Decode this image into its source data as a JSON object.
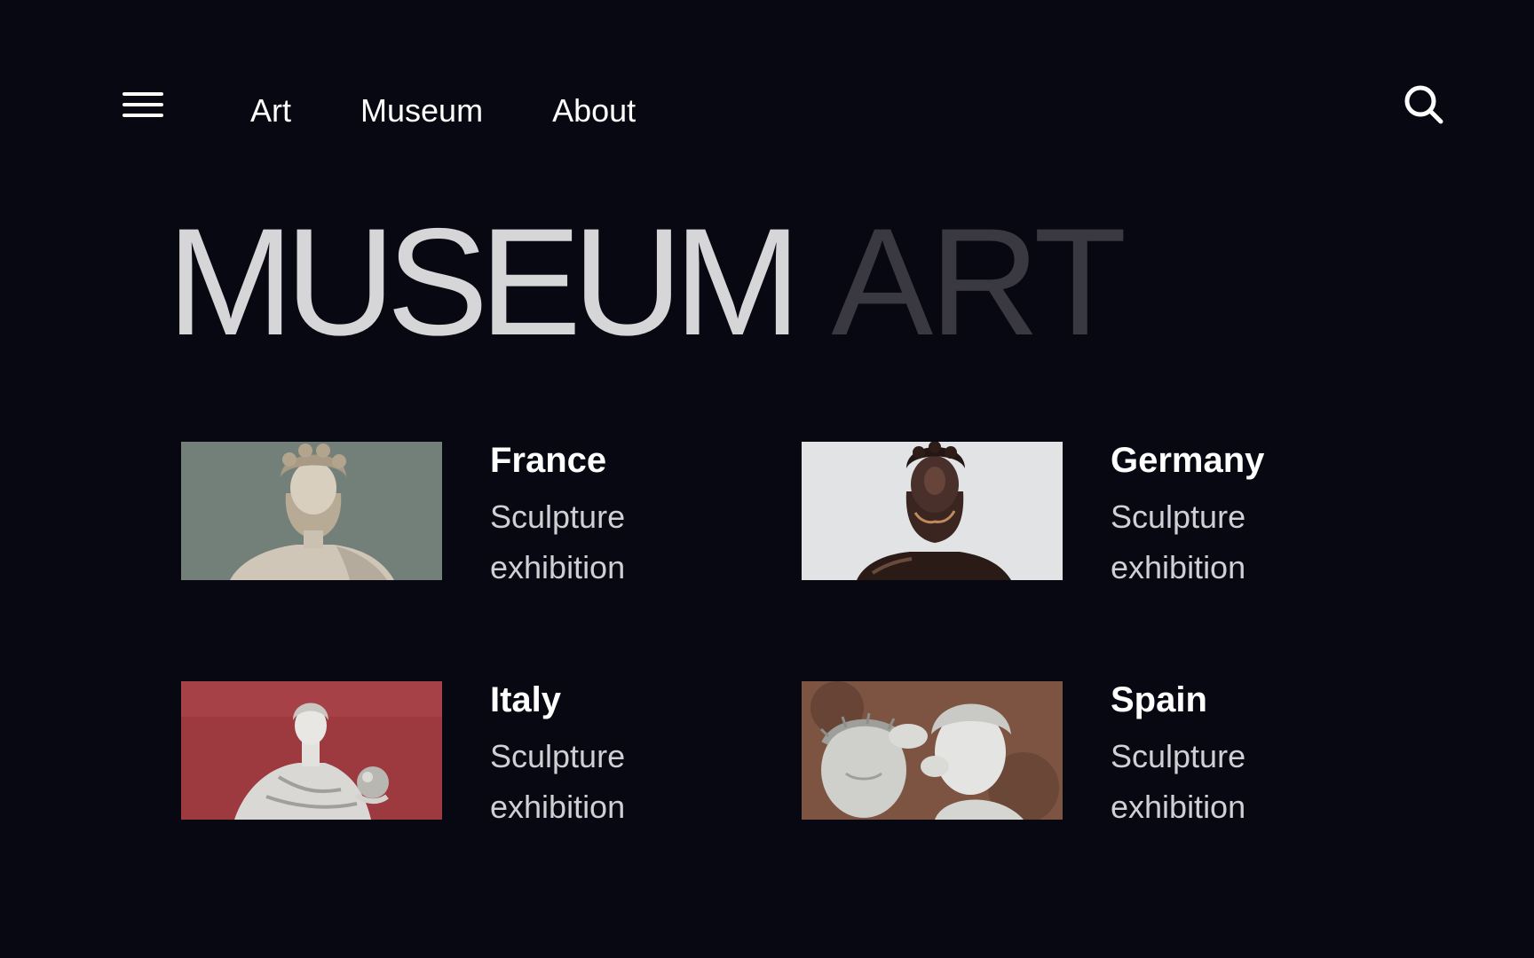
{
  "nav": {
    "items": [
      {
        "label": "Art"
      },
      {
        "label": "Museum"
      },
      {
        "label": "About"
      }
    ]
  },
  "icons": {
    "menu": "hamburger-menu-icon",
    "search": "search-icon"
  },
  "hero": {
    "word1": "MUSEUM",
    "word2": "ART"
  },
  "colors": {
    "background": "#070812",
    "hero_primary": "#d6d5d7",
    "hero_secondary": "#3a3941",
    "subtitle": "#cfcfd4"
  },
  "cards": [
    {
      "title": "France",
      "line1": "Sculpture",
      "line2": "exhibition",
      "image": "marble bearded bust on grey-green background"
    },
    {
      "title": "Germany",
      "line1": "Sculpture",
      "line2": "exhibition",
      "image": "dark bronze bearded bust on light background"
    },
    {
      "title": "Italy",
      "line1": "Sculpture",
      "line2": "exhibition",
      "image": "white statue of woman holding sphere on red background"
    },
    {
      "title": "Spain",
      "line1": "Sculpture",
      "line2": "exhibition",
      "image": "white marble figures with crown of thorns and helmet"
    }
  ]
}
